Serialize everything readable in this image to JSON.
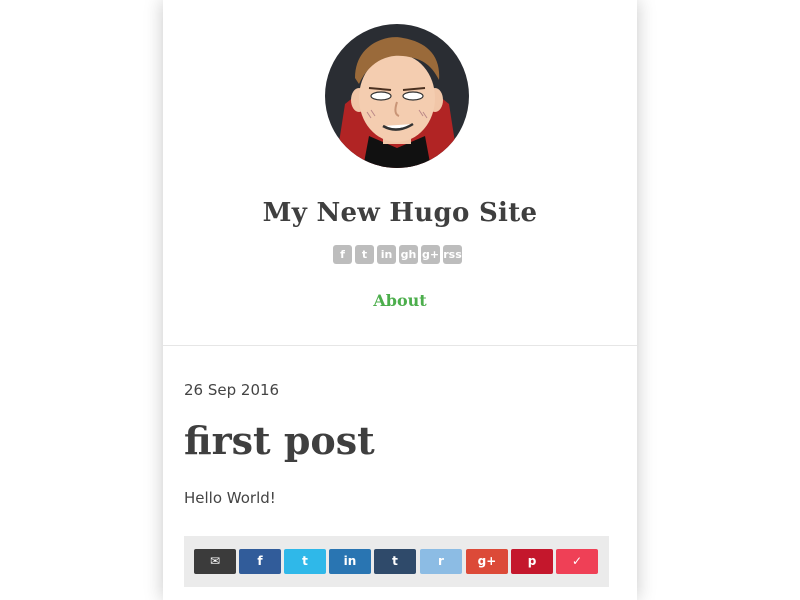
{
  "site": {
    "title": "My New Hugo Site"
  },
  "social_icons": [
    {
      "name": "facebook-icon",
      "glyph": "f"
    },
    {
      "name": "twitter-icon",
      "glyph": "t"
    },
    {
      "name": "linkedin-icon",
      "glyph": "in"
    },
    {
      "name": "github-icon",
      "glyph": "gh"
    },
    {
      "name": "googleplus-icon",
      "glyph": "g+"
    },
    {
      "name": "rss-icon",
      "glyph": "rss"
    }
  ],
  "nav": {
    "about_label": "About"
  },
  "post": {
    "date": "26 Sep 2016",
    "title": "first post",
    "body": "Hello World!"
  },
  "share_buttons": [
    {
      "name": "share-email-button",
      "glyph": "✉",
      "color": "#3b3b3b"
    },
    {
      "name": "share-facebook-button",
      "glyph": "f",
      "color": "#315c9a"
    },
    {
      "name": "share-twitter-button",
      "glyph": "t",
      "color": "#2fb8e9"
    },
    {
      "name": "share-linkedin-button",
      "glyph": "in",
      "color": "#2975b2"
    },
    {
      "name": "share-tumblr-button",
      "glyph": "t",
      "color": "#2f4a6a"
    },
    {
      "name": "share-reddit-button",
      "glyph": "r",
      "color": "#8cbce4"
    },
    {
      "name": "share-googleplus-button",
      "glyph": "g+",
      "color": "#dc4a38"
    },
    {
      "name": "share-pinterest-button",
      "glyph": "p",
      "color": "#c4172c"
    },
    {
      "name": "share-pocket-button",
      "glyph": "✓",
      "color": "#ef4056"
    }
  ],
  "colors": {
    "accent_link": "#4cae4c",
    "text_dark": "#3f3f3f",
    "social_icon_gray": "#bdbdbd",
    "share_bar_bg": "#ebebeb"
  }
}
